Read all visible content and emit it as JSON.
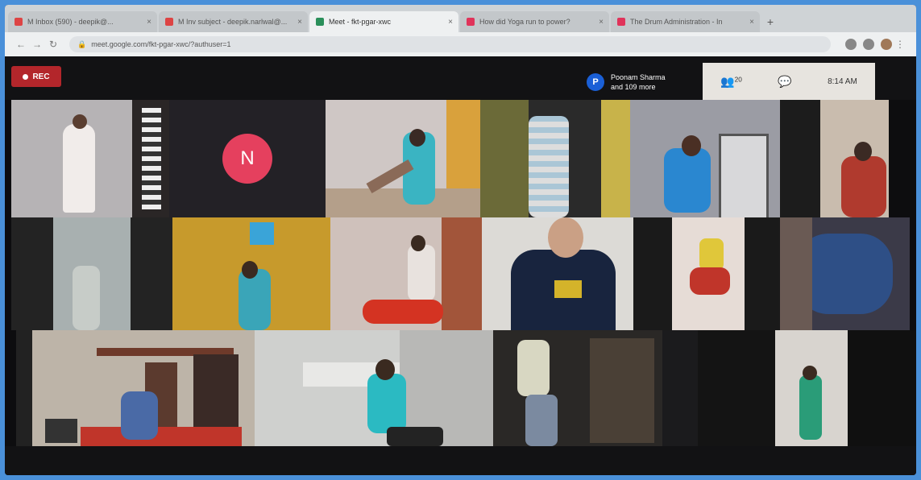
{
  "browser": {
    "tabs": [
      {
        "label": "M  Inbox (590) - deepik@...",
        "color": "#d44"
      },
      {
        "label": "M  Inv subject  - deepik.narlwal@...",
        "color": "#d44"
      },
      {
        "label": "Meet - fkt-pgar-xwc",
        "color": "#2a8f5a"
      },
      {
        "label": "How did Yoga run to power?",
        "color": "#e0335a"
      },
      {
        "label": "The Drum Administration - In",
        "color": "#e0335a"
      }
    ],
    "url": "meet.google.com/fkt-pgar-xwc/?authuser=1"
  },
  "meet": {
    "rec_label": "REC",
    "presenter_initial": "P",
    "presenter_name": "Poonam Sharma",
    "presenter_more": "and 109 more",
    "people_count": "20",
    "time": "8:14 AM",
    "participant_initial": "N"
  }
}
